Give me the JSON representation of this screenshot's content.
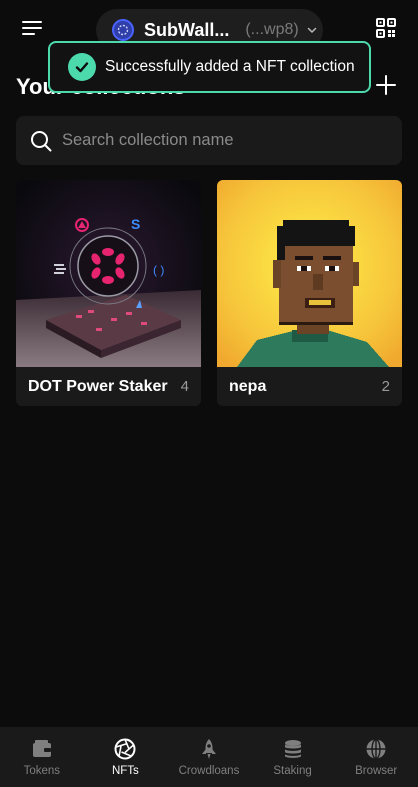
{
  "header": {
    "account_name": "SubWall...",
    "account_address": "(...wp8)",
    "menu_icon": "menu-icon",
    "qr_icon": "qr-code-icon"
  },
  "toast": {
    "message": "Successfully added a NFT collection",
    "icon": "check-circle-icon",
    "color": "#4cd9ac"
  },
  "main": {
    "title": "Your collections",
    "search_placeholder": "Search collection name",
    "collections": [
      {
        "name": "DOT Power Staker",
        "count": "4"
      },
      {
        "name": "nepa",
        "count": "2"
      }
    ]
  },
  "bottom_nav": {
    "items": [
      {
        "label": "Tokens",
        "icon": "wallet-icon",
        "active": false
      },
      {
        "label": "NFTs",
        "icon": "aperture-icon",
        "active": true
      },
      {
        "label": "Crowdloans",
        "icon": "rocket-icon",
        "active": false
      },
      {
        "label": "Staking",
        "icon": "database-icon",
        "active": false
      },
      {
        "label": "Browser",
        "icon": "globe-icon",
        "active": false
      }
    ]
  }
}
